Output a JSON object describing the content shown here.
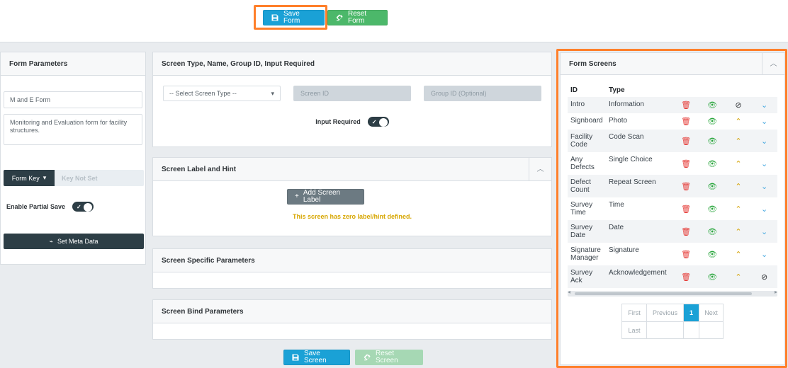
{
  "toolbar": {
    "save_form": "Save Form",
    "reset_form": "Reset Form"
  },
  "left_panel": {
    "title": "Form Parameters",
    "form_name": "M and E Form",
    "form_description": "Monitoring and Evaluation form for facility structures.",
    "form_key_label": "Form Key",
    "key_not_set": "Key Not Set",
    "enable_partial_save": "Enable Partial Save",
    "set_meta_data": "Set Meta Data"
  },
  "screen_type_panel": {
    "title": "Screen Type, Name, Group ID, Input Required",
    "select_screen_type": "-- Select Screen Type --",
    "screen_id_placeholder": "Screen ID",
    "group_id_placeholder": "Group ID (Optional)",
    "input_required": "Input Required"
  },
  "label_hint_panel": {
    "title": "Screen Label and Hint",
    "add_screen_label": "Add Screen Label",
    "zero_label_text": "This screen has zero label/hint defined."
  },
  "screen_specific_panel": {
    "title": "Screen Specific Parameters"
  },
  "screen_bind_panel": {
    "title": "Screen Bind Parameters"
  },
  "bottom_actions": {
    "save_screen": "Save Screen",
    "reset_screen": "Reset Screen"
  },
  "form_screens": {
    "title": "Form Screens",
    "columns": [
      "ID",
      "Type"
    ],
    "rows": [
      {
        "id": "Intro",
        "type": "Information",
        "actions": [
          "trash",
          "eye",
          "ban",
          "down"
        ]
      },
      {
        "id": "Signboard",
        "type": "Photo",
        "actions": [
          "trash",
          "eye",
          "up",
          "down"
        ]
      },
      {
        "id": "Facility Code",
        "type": "Code Scan",
        "actions": [
          "trash",
          "eye",
          "up",
          "down"
        ]
      },
      {
        "id": "Any Defects",
        "type": "Single Choice",
        "actions": [
          "trash",
          "eye",
          "up",
          "down"
        ]
      },
      {
        "id": "Defect Count",
        "type": "Repeat Screen",
        "actions": [
          "trash",
          "eye",
          "up",
          "down"
        ]
      },
      {
        "id": "Survey Time",
        "type": "Time",
        "actions": [
          "trash",
          "eye",
          "up",
          "down"
        ]
      },
      {
        "id": "Survey Date",
        "type": "Date",
        "actions": [
          "trash",
          "eye",
          "up",
          "down"
        ]
      },
      {
        "id": "Signature Manager",
        "type": "Signature",
        "actions": [
          "trash",
          "eye",
          "up",
          "down"
        ]
      },
      {
        "id": "Survey Ack",
        "type": "Acknowledgement",
        "actions": [
          "trash",
          "eye",
          "up",
          "ban"
        ]
      }
    ],
    "pagination": {
      "first": "First",
      "previous": "Previous",
      "page": "1",
      "next": "Next",
      "last": "Last"
    }
  },
  "colors": {
    "primary": "#1aa1d6",
    "success": "#4cb86a",
    "highlight": "#ff7f2a",
    "dark": "#2d3e46"
  }
}
